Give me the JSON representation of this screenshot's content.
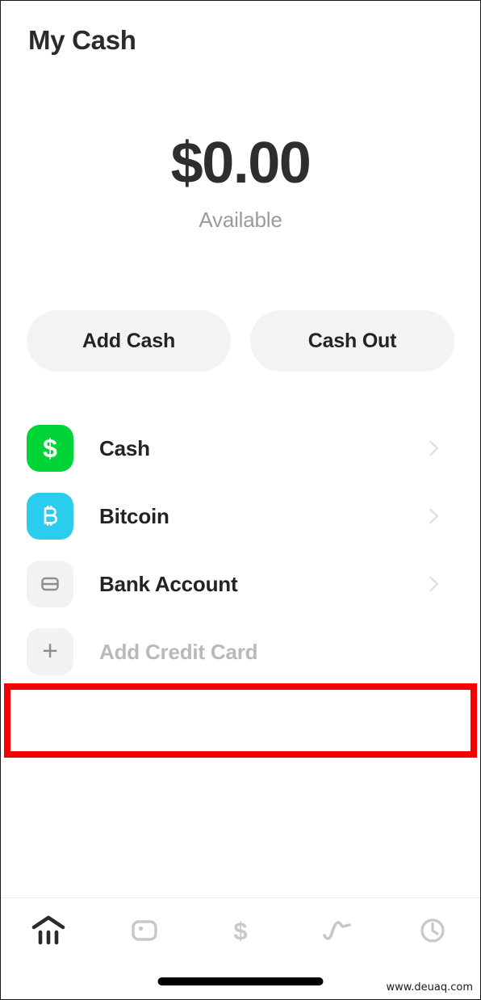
{
  "header": {
    "title": "My Cash"
  },
  "balance": {
    "amount": "$0.00",
    "caption": "Available"
  },
  "actions": [
    {
      "label": "Add Cash",
      "name": "add-cash-button"
    },
    {
      "label": "Cash Out",
      "name": "cash-out-button"
    }
  ],
  "accounts": [
    {
      "label": "Cash",
      "icon": "dollar-sign-icon",
      "tile_color": "#00D437",
      "glyph": "$",
      "chevron": true,
      "muted": false
    },
    {
      "label": "Bitcoin",
      "icon": "bitcoin-icon",
      "tile_color": "#2ACDEE",
      "glyph": "B",
      "chevron": true,
      "muted": false
    },
    {
      "label": "Bank Account",
      "icon": "credit-card-icon",
      "tile_color": "#F2F2F2",
      "glyph": "",
      "chevron": true,
      "muted": false
    },
    {
      "label": "Add Credit Card",
      "icon": "plus-icon",
      "tile_color": "#F2F2F2",
      "glyph": "+",
      "chevron": false,
      "muted": true
    }
  ],
  "annotation": {
    "target": "Add Credit Card",
    "color": "#F40000"
  },
  "bottom_nav": [
    {
      "name": "nav-banking",
      "icon": "bank-home-icon",
      "active": true
    },
    {
      "name": "nav-card",
      "icon": "cash-card-icon",
      "active": false
    },
    {
      "name": "nav-payment",
      "icon": "dollar-sign-icon",
      "active": false
    },
    {
      "name": "nav-investing",
      "icon": "wave-line-icon",
      "active": false
    },
    {
      "name": "nav-activity",
      "icon": "clock-icon",
      "active": false
    }
  ],
  "colors": {
    "cash_green": "#00D437",
    "bitcoin_cyan": "#2ACDEE",
    "highlight_red": "#F40000",
    "tile_neutral": "#F2F2F2",
    "button_bg": "#F3F3F3",
    "text_primary": "#232323",
    "text_muted": "#9B9B9B",
    "nav_inactive": "#C8C8C8",
    "nav_active": "#2B2B2B"
  },
  "watermark": {
    "text": "www.deuaq.com"
  }
}
